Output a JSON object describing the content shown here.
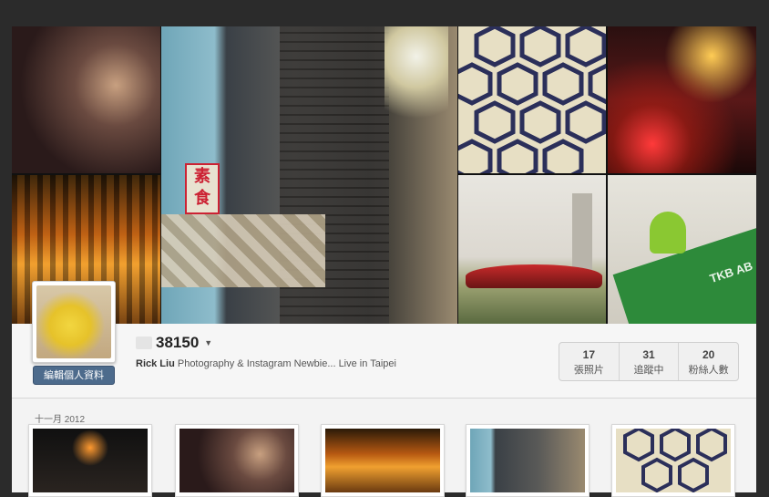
{
  "profile": {
    "username": "38150",
    "display_name": "Rick Liu",
    "bio": "Photography & Instagram Newbie... Live in Taipei",
    "edit_button": "編輯個人資料"
  },
  "stats": [
    {
      "value": "17",
      "label": "張照片"
    },
    {
      "value": "31",
      "label": "追蹤中"
    },
    {
      "value": "20",
      "label": "粉絲人數"
    }
  ],
  "mosaic": {
    "sign_text": "素食",
    "green_card_text": "TKB AB"
  },
  "feed": {
    "month_label": "十一月 2012"
  },
  "icons": {
    "caret": "caret-down-icon"
  }
}
